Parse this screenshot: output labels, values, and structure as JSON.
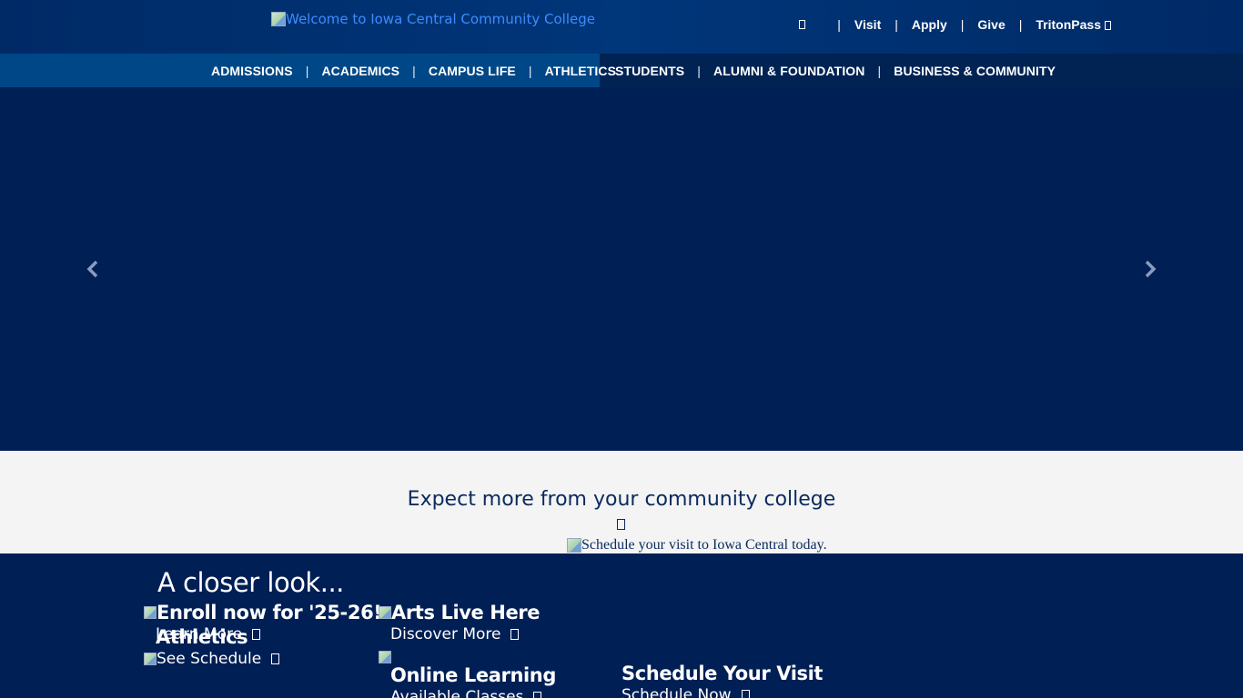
{
  "header": {
    "logo_alt": "Welcome to Iowa Central Community College",
    "utility_links": [
      "Visit",
      "Apply",
      "Give",
      "TritonPass"
    ],
    "separator": "|"
  },
  "main_nav": {
    "left_items": [
      "ADMISSIONS",
      "ACADEMICS",
      "CAMPUS LIFE",
      "ATHLETICS"
    ],
    "right_items": [
      "STUDENTS",
      "ALUMNI & FOUNDATION",
      "BUSINESS & COMMUNITY"
    ]
  },
  "hero": {
    "prev_arrow": "‹",
    "next_arrow": "›"
  },
  "expect": {
    "title": "Expect more from your community college",
    "visit_img_alt": "Schedule your visit to Iowa Central today."
  },
  "closer": {
    "title": "A closer look...",
    "tiles": [
      {
        "headline": "Enroll now for '25-26!",
        "cta": "Learn More"
      },
      {
        "headline": "Athletics",
        "cta": "See Schedule"
      },
      {
        "headline": "Arts Live Here",
        "cta": "Discover More"
      },
      {
        "headline": "Online Learning",
        "cta": "Available Classes"
      },
      {
        "headline": "Schedule Your Visit",
        "cta": "Schedule Now"
      }
    ]
  },
  "colors": {
    "header_bg": "#00367a",
    "nav_left_bg": "#004787",
    "nav_right_bg": "#002354",
    "hero_bg": "#001f55",
    "band_bg": "#f4f4f4",
    "title_text": "#0a2a5e",
    "link_blue": "#3d8cff"
  }
}
